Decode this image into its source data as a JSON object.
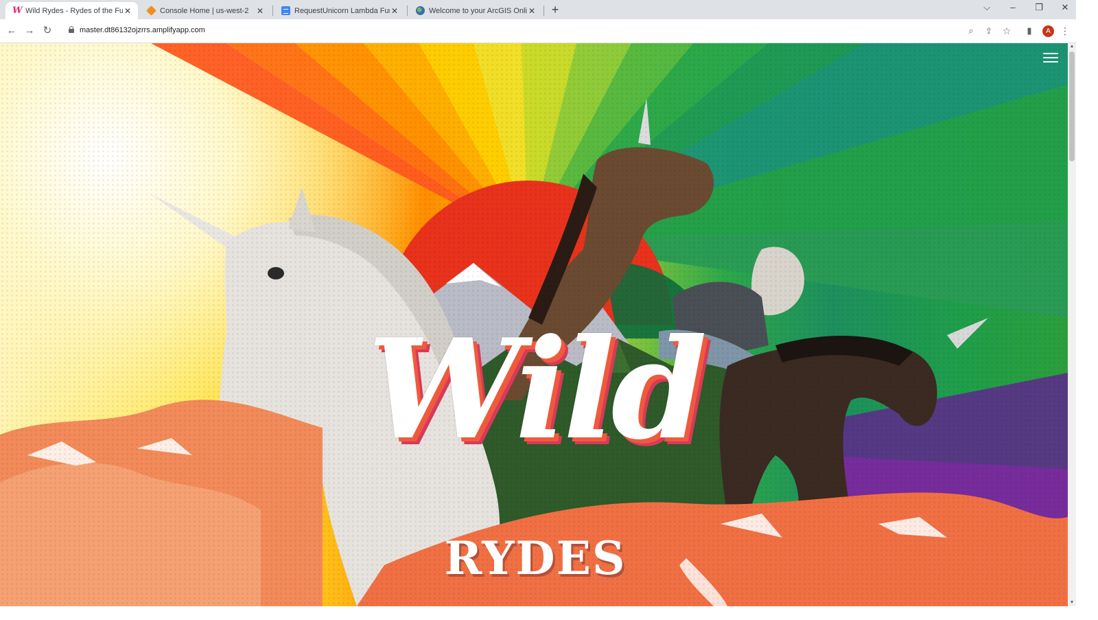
{
  "browser": {
    "tabs": [
      {
        "title": "Wild Rydes - Rydes of the Future",
        "favicon": "wild-rydes-favicon",
        "active": true
      },
      {
        "title": "Console Home | us-west-2",
        "favicon": "aws-favicon",
        "active": false
      },
      {
        "title": "RequestUnicorn Lambda Function",
        "favicon": "docs-favicon",
        "active": false
      },
      {
        "title": "Welcome to your ArcGIS Online",
        "favicon": "arcgis-favicon",
        "active": false
      }
    ],
    "new_tab_label": "+",
    "url": "master.dt86132ojzrrs.amplifyapp.com",
    "profile_initial": "A",
    "icons": {
      "back": "back-arrow-icon",
      "forward": "forward-arrow-icon",
      "reload": "reload-icon",
      "lock": "lock-icon",
      "zoom": "zoom-icon",
      "share": "share-icon",
      "bookmark": "star-icon",
      "side_panel": "side-panel-icon",
      "menu": "kebab-menu-icon"
    }
  },
  "page": {
    "logo_word_1": "Wild",
    "logo_word_2": "RYDES",
    "nav_icon": "hamburger-menu-icon",
    "colors": {
      "logo_shadow": "#f05a3c",
      "rainbow": [
        "#ff5a1f",
        "#ff8c00",
        "#ffc400",
        "#d8e021",
        "#6fc03b",
        "#1fa34a",
        "#1b8a6a"
      ]
    }
  }
}
